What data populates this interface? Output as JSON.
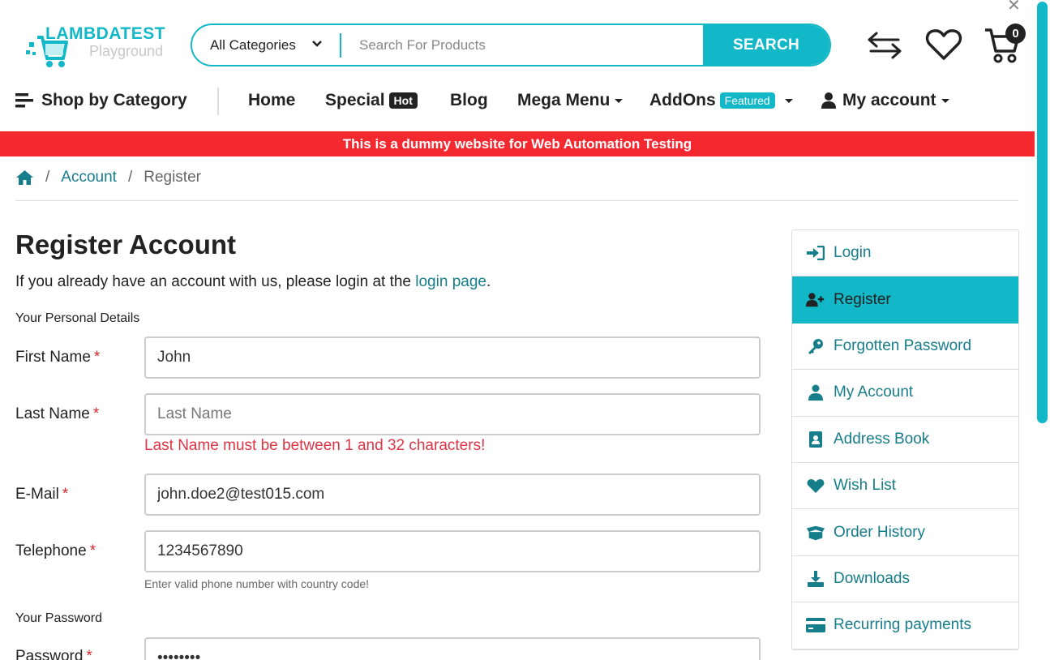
{
  "colors": {
    "accent": "#12b8c7",
    "banner": "#f42930",
    "link": "#167d8a",
    "error": "#dc3545"
  },
  "logo": {
    "text1": "LAMBDATEST",
    "text2": "Playground"
  },
  "search": {
    "category": "All Categories",
    "placeholder": "Search For Products",
    "button": "SEARCH"
  },
  "cart": {
    "count": "0"
  },
  "nav": {
    "shop_by_category": "Shop by Category",
    "home": "Home",
    "special": "Special",
    "special_badge": "Hot",
    "blog": "Blog",
    "mega_menu": "Mega Menu",
    "addons": "AddOns",
    "addons_badge": "Featured",
    "my_account": "My account"
  },
  "banner": "This is a dummy website for Web Automation Testing",
  "breadcrumb": {
    "account": "Account",
    "current": "Register",
    "sep": "/"
  },
  "page": {
    "title": "Register Account",
    "intro_prefix": "If you already have an account with us, please login at the ",
    "intro_link": "login page",
    "intro_suffix": ".",
    "personal_details": "Your Personal Details",
    "password_section": "Your Password"
  },
  "form": {
    "first_name": {
      "label": "First Name",
      "value": "John",
      "placeholder": "First Name"
    },
    "last_name": {
      "label": "Last Name",
      "value": "",
      "placeholder": "Last Name",
      "error": "Last Name must be between 1 and 32 characters!"
    },
    "email": {
      "label": "E-Mail",
      "value": "john.doe2@test015.com",
      "placeholder": "E-Mail"
    },
    "telephone": {
      "label": "Telephone",
      "value": "1234567890",
      "placeholder": "Telephone",
      "help": "Enter valid phone number with country code!"
    },
    "password": {
      "label": "Password",
      "value": "password"
    },
    "required_mark": "*"
  },
  "sidebar": {
    "items": [
      {
        "label": "Login",
        "icon": "sign-in-icon"
      },
      {
        "label": "Register",
        "icon": "user-plus-icon"
      },
      {
        "label": "Forgotten Password",
        "icon": "key-icon"
      },
      {
        "label": "My Account",
        "icon": "user-icon"
      },
      {
        "label": "Address Book",
        "icon": "address-book-icon"
      },
      {
        "label": "Wish List",
        "icon": "heart-icon"
      },
      {
        "label": "Order History",
        "icon": "box-open-icon"
      },
      {
        "label": "Downloads",
        "icon": "download-icon"
      },
      {
        "label": "Recurring payments",
        "icon": "credit-card-icon"
      }
    ]
  }
}
